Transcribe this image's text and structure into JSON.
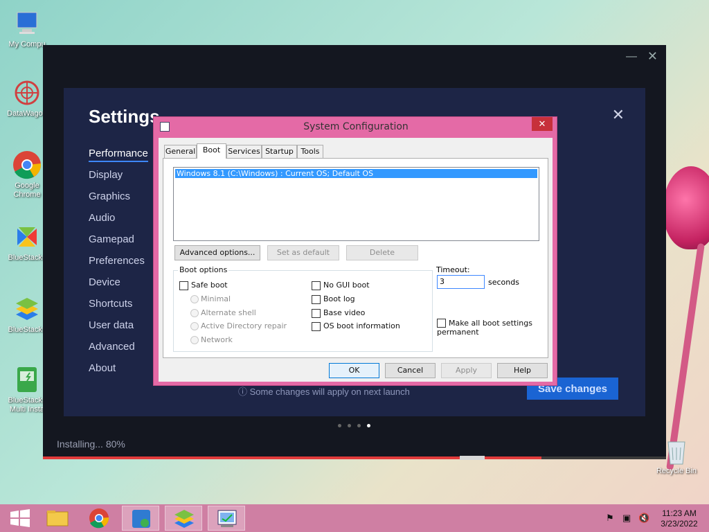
{
  "desktop": {
    "icons": [
      {
        "label": "My Compu"
      },
      {
        "label": "DataWagon"
      },
      {
        "label": "Google Chrome"
      },
      {
        "label": "BlueStacks"
      },
      {
        "label": "BlueStacks"
      },
      {
        "label": "BlueStacks Multi Insta"
      }
    ],
    "recycle_bin": "Recycle Bin"
  },
  "bluestacks": {
    "title": "Settings",
    "nav": [
      "Performance",
      "Display",
      "Graphics",
      "Audio",
      "Gamepad",
      "Preferences",
      "Device",
      "Shortcuts",
      "User data",
      "Advanced",
      "About"
    ],
    "active_nav": "Performance",
    "note": "ⓘ Some changes will apply on next launch",
    "save_label": "Save changes",
    "installing": "Installing... 80%",
    "progress": 0.8,
    "page_dots": 4,
    "active_dot": 3
  },
  "dialog": {
    "title": "System Configuration",
    "close": "✕",
    "tabs": [
      "General",
      "Boot",
      "Services",
      "Startup",
      "Tools"
    ],
    "selected_tab": "Boot",
    "os_entry": "Windows 8.1 (C:\\Windows) : Current OS; Default OS",
    "advanced_label": "Advanced options...",
    "set_default_label": "Set as default",
    "delete_label": "Delete",
    "boot_options_label": "Boot options",
    "safe_boot": "Safe boot",
    "minimal": "Minimal",
    "alternate_shell": "Alternate shell",
    "ad_repair": "Active Directory repair",
    "network": "Network",
    "no_gui": "No GUI boot",
    "boot_log": "Boot log",
    "base_video": "Base video",
    "os_boot_info": "OS boot information",
    "timeout_label": "Timeout:",
    "timeout_value": "3",
    "seconds": "seconds",
    "make_permanent": "Make all boot settings permanent",
    "ok": "OK",
    "cancel": "Cancel",
    "apply": "Apply",
    "help": "Help"
  },
  "taskbar": {
    "time": "11:23 AM",
    "date": "3/23/2022"
  },
  "colors": {
    "accent": "#1a64d3",
    "dialog_frame": "#e46aa6",
    "taskbar": "#cf7fa3"
  }
}
